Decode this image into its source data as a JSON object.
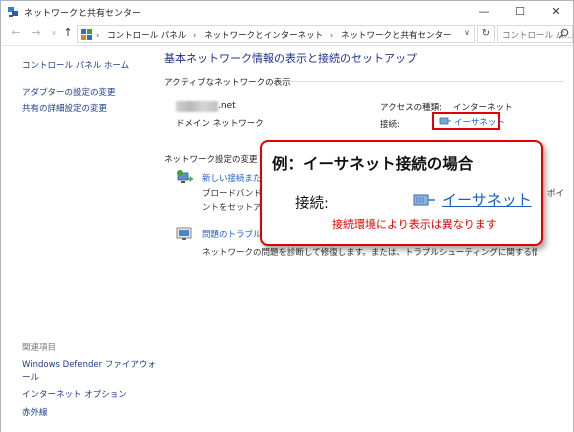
{
  "window": {
    "title": "ネットワークと共有センター",
    "minimize": "—",
    "maximize": "☐",
    "close": "✕"
  },
  "nav": {
    "back_icon": "back-arrow-icon",
    "forward_icon": "forward-arrow-icon",
    "recent_icon": "dropdown-icon",
    "up_icon": "up-arrow-icon"
  },
  "address": {
    "crumbs": [
      "コントロール パネル",
      "ネットワークとインターネット",
      "ネットワークと共有センター"
    ],
    "refresh_icon": "refresh-icon"
  },
  "search": {
    "placeholder": "コントロール パ..."
  },
  "left_pane": {
    "home": "コントロール パネル ホーム",
    "links": [
      "アダプターの設定の変更",
      "共有の詳細設定の変更"
    ],
    "related_heading": "関連項目",
    "related": [
      "Windows Defender ファイアウォ",
      "ール",
      "インターネット オプション",
      "赤外線"
    ]
  },
  "main": {
    "title": "基本ネットワーク情報の表示と接続のセットアップ",
    "active_networks_heading": "アクティブなネットワークの表示",
    "network": {
      "name": ".net",
      "category": "ドメイン ネットワーク",
      "access_type_label": "アクセスの種類:",
      "access_type_value": "インターネット",
      "connections_label": "接続:",
      "connection_value": "イーサネット"
    },
    "change_settings_heading": "ネットワーク設定の変更",
    "tasks": [
      {
        "link": "新しい接続またはネ",
        "desc1": "ブロードバンド、ダ",
        "desc1_tail": "ポイ",
        "desc2": "ントをセットアップ"
      },
      {
        "link": "問題のトラブルシ",
        "desc1": "ネットワークの問題を診断して修復します。または、トラブルシューティングに関する情報を入手します。"
      }
    ]
  },
  "callout": {
    "heading": "例：イーサネット接続の場合",
    "label": "接続:",
    "link": "イーサネット",
    "note": "接続環境により表示は異なります"
  },
  "colors": {
    "accent_red": "#e00000",
    "link_blue": "#1a5fc8",
    "title_blue": "#1e3287"
  }
}
